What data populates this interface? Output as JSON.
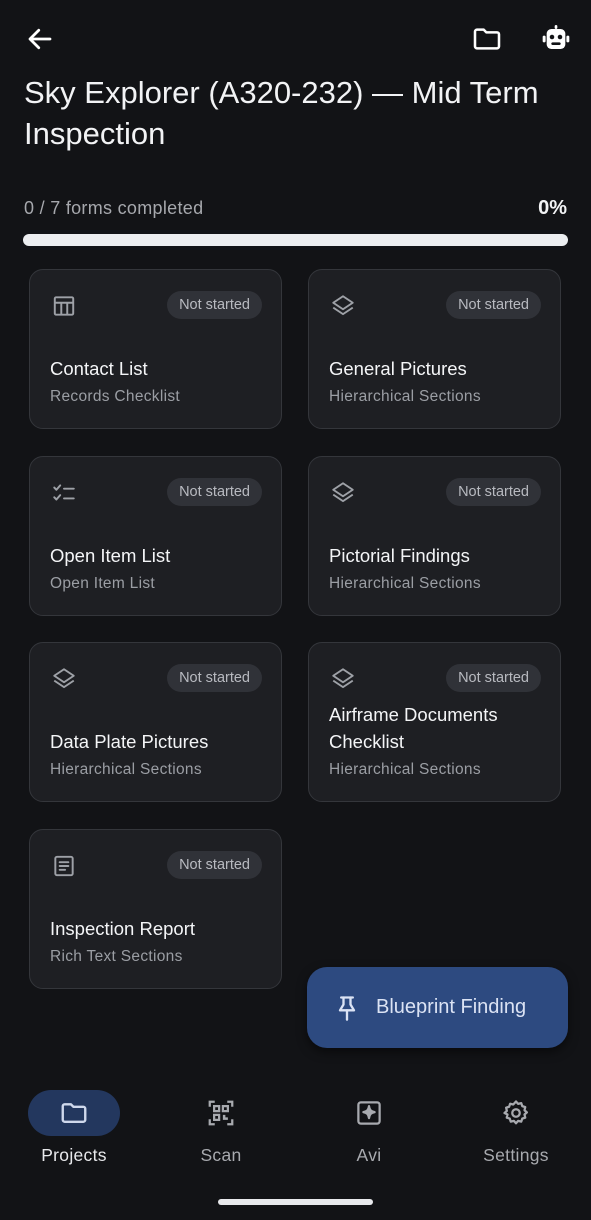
{
  "header": {
    "title": "Sky Explorer (A320-232) — Mid Term Inspection",
    "back_icon": "arrow-left-icon",
    "folder_icon": "folder-icon",
    "robot_icon": "robot-icon"
  },
  "progress": {
    "label": "0 / 7 forms completed",
    "percent_label": "0%",
    "value": 0
  },
  "forms": [
    {
      "icon": "table-icon",
      "status": "Not started",
      "title": "Contact List",
      "subtitle": "Records Checklist"
    },
    {
      "icon": "layers-icon",
      "status": "Not started",
      "title": "General Pictures",
      "subtitle": "Hierarchical Sections"
    },
    {
      "icon": "checklist-icon",
      "status": "Not started",
      "title": "Open Item List",
      "subtitle": "Open Item List"
    },
    {
      "icon": "layers-icon",
      "status": "Not started",
      "title": "Pictorial Findings",
      "subtitle": "Hierarchical Sections"
    },
    {
      "icon": "layers-icon",
      "status": "Not started",
      "title": "Data Plate Pictures",
      "subtitle": "Hierarchical Sections"
    },
    {
      "icon": "layers-icon",
      "status": "Not started",
      "title": "Airframe Documents Checklist",
      "subtitle": "Hierarchical Sections"
    },
    {
      "icon": "document-icon",
      "status": "Not started",
      "title": "Inspection Report",
      "subtitle": "Rich Text Sections"
    }
  ],
  "fab": {
    "icon": "pin-icon",
    "label": "Blueprint Finding"
  },
  "nav": [
    {
      "icon": "folder-icon",
      "label": "Projects",
      "active": true
    },
    {
      "icon": "qr-code-icon",
      "label": "Scan",
      "active": false
    },
    {
      "icon": "sparkle-icon",
      "label": "Avi",
      "active": false
    },
    {
      "icon": "settings-icon",
      "label": "Settings",
      "active": false
    }
  ],
  "colors": {
    "background": "#121316",
    "card": "#1e1f23",
    "accent": "#2d4a80",
    "nav_active": "#23375e"
  }
}
